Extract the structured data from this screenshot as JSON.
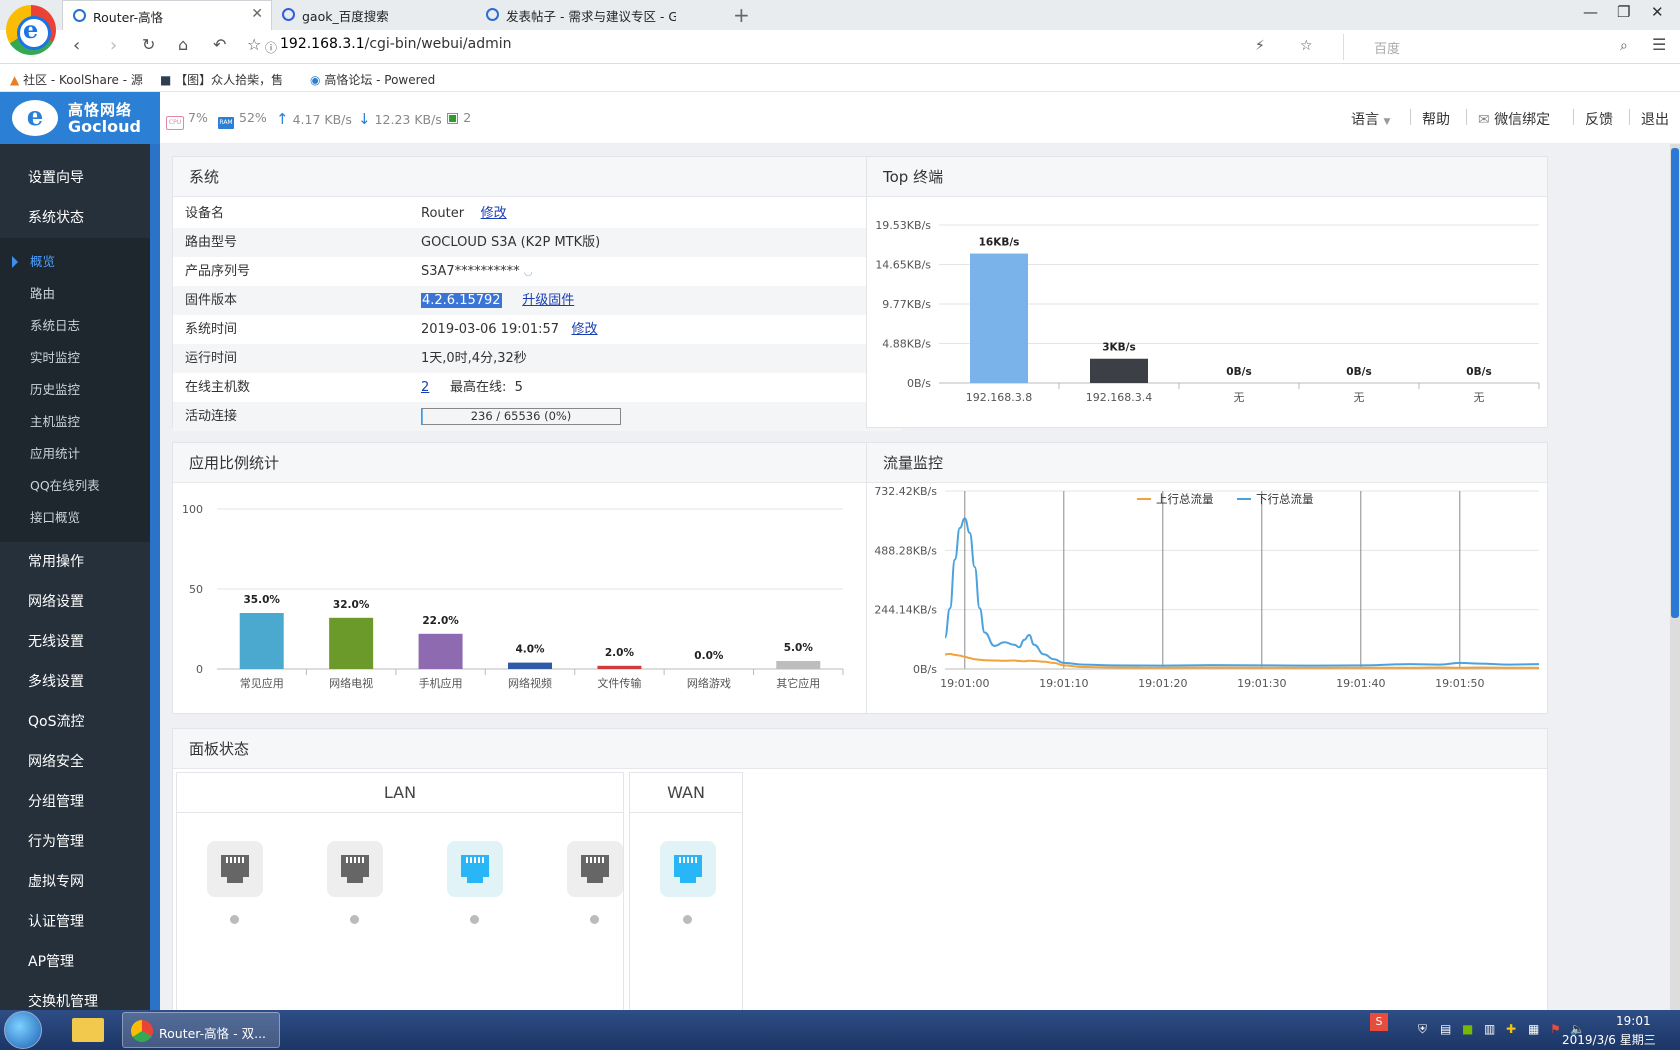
{
  "browser": {
    "tabs": [
      {
        "title": "Router-高恪"
      },
      {
        "title": "gaok_百度搜索"
      },
      {
        "title": "发表帖子 - 需求与建议专区 - GOC"
      }
    ],
    "url_host": "192.168.3.1",
    "url_path": "/cgi-bin/webui/admin",
    "search_placeholder": "百度",
    "bookmarks": [
      "社区 - KoolShare - 源",
      "【图】众人拾柴，售",
      "高恪论坛 - Powered"
    ]
  },
  "router": {
    "brand_cn": "高恪网络",
    "brand_en": "Gocloud",
    "stats": {
      "cpu": "7%",
      "ram": "52%",
      "up": "4.17 KB/s",
      "down": "12.23 KB/s",
      "clients": "2"
    },
    "header_menu": {
      "language": "语言",
      "help": "帮助",
      "wechat": "微信绑定",
      "feedback": "反馈",
      "logout": "退出"
    }
  },
  "sidebar": {
    "top_items": [
      "设置向导",
      "系统状态"
    ],
    "sub_items": [
      "概览",
      "路由",
      "系统日志",
      "实时监控",
      "历史监控",
      "主机监控",
      "应用统计",
      "QQ在线列表",
      "接口概览"
    ],
    "bottom_items": [
      "常用操作",
      "网络设置",
      "无线设置",
      "多线设置",
      "QoS流控",
      "网络安全",
      "分组管理",
      "行为管理",
      "虚拟专网",
      "认证管理",
      "AP管理",
      "交换机管理"
    ]
  },
  "system": {
    "title": "系统",
    "device_name_label": "设备名",
    "device_name": "Router",
    "edit": "修改",
    "model_label": "路由型号",
    "model": "GOCLOUD S3A (K2P MTK版)",
    "serial_label": "产品序列号",
    "serial": "S3A7**********",
    "firmware_label": "固件版本",
    "firmware": "4.2.6.15792",
    "upgrade": "升级固件",
    "time_label": "系统时间",
    "time": "2019-03-06 19:01:57",
    "uptime_label": "运行时间",
    "uptime": "1天,0时,4分,32秒",
    "hosts_label": "在线主机数",
    "hosts": "2",
    "max_label": "最高在线:",
    "max": "5",
    "conn_label": "活动连接",
    "conn": "236 / 65536 (0%)",
    "conn_fraction": 0.0036
  },
  "top_title": "Top 终端",
  "app_title": "应用比例统计",
  "traffic_title": "流量监控",
  "panel_status": {
    "title": "面板状态",
    "lan": "LAN",
    "wan": "WAN",
    "lan_ports_active": [
      false,
      false,
      true,
      false
    ],
    "wan_active": [
      true
    ]
  },
  "taskbar": {
    "task": "Router-高恪 - 双...",
    "time": "19:01",
    "date": "2019/3/6 星期三"
  },
  "colors": {
    "bar_top1": "#7ab3ea",
    "bar_top2": "#3d3f46",
    "up_line": "#f5a13a",
    "down_line": "#4aa3df",
    "active_port": "#29b6f6"
  },
  "chart_data": [
    {
      "type": "bar",
      "ytick_labels": [
        "0B/s",
        "4.88KB/s",
        "9.77KB/s",
        "14.65KB/s",
        "19.53KB/s"
      ],
      "categories": [
        "192.168.3.8",
        "192.168.3.4",
        "无",
        "无",
        "无"
      ],
      "values": [
        16,
        3,
        0,
        0,
        0
      ],
      "data_labels": [
        "16KB/s",
        "3KB/s",
        "0B/s",
        "0B/s",
        "0B/s"
      ],
      "ylim": [
        0,
        19.53
      ]
    },
    {
      "type": "bar",
      "categories": [
        "常见应用",
        "网络电视",
        "手机应用",
        "网络视频",
        "文件传输",
        "网络游戏",
        "其它应用"
      ],
      "values": [
        35.0,
        32.0,
        22.0,
        4.0,
        2.0,
        0.0,
        5.0
      ],
      "data_labels": [
        "35.0%",
        "32.0%",
        "22.0%",
        "4.0%",
        "2.0%",
        "0.0%",
        "5.0%"
      ],
      "colors": [
        "#4ba8cf",
        "#6b9a2b",
        "#8e6bb0",
        "#2f5aa8",
        "#d23b3b",
        "#e08a2a",
        "#bdbdbd"
      ],
      "ytick_labels": [
        "0",
        "50",
        "100"
      ],
      "ylim": [
        0,
        100
      ]
    },
    {
      "type": "line",
      "ytick_labels": [
        "0B/s",
        "244.14KB/s",
        "488.28KB/s",
        "732.42KB/s"
      ],
      "ylim": [
        0,
        732.42
      ],
      "xtick_labels": [
        "19:01:00",
        "19:01:10",
        "19:01:20",
        "19:01:30",
        "19:01:40",
        "19:01:50"
      ],
      "x": [
        -2,
        -1.5,
        -1,
        -0.5,
        0,
        0.5,
        1,
        1.5,
        2,
        3,
        4,
        5,
        5.5,
        6,
        6.5,
        7,
        8,
        9,
        10,
        12,
        15,
        20,
        25,
        30,
        35,
        40,
        45,
        48,
        50,
        52,
        55,
        58
      ],
      "series": [
        {
          "name": "上行总流量",
          "values": [
            60,
            62,
            58,
            55,
            50,
            45,
            40,
            38,
            36,
            35,
            34,
            35,
            33,
            32,
            34,
            33,
            30,
            25,
            15,
            8,
            6,
            5,
            6,
            5,
            5,
            5,
            5,
            6,
            5,
            6,
            5,
            5
          ]
        },
        {
          "name": "下行总流量",
          "values": [
            130,
            250,
            450,
            580,
            620,
            560,
            420,
            250,
            150,
            95,
            110,
            100,
            90,
            120,
            140,
            100,
            60,
            40,
            25,
            18,
            15,
            14,
            16,
            15,
            14,
            15,
            20,
            18,
            25,
            22,
            18,
            20
          ]
        }
      ]
    }
  ]
}
